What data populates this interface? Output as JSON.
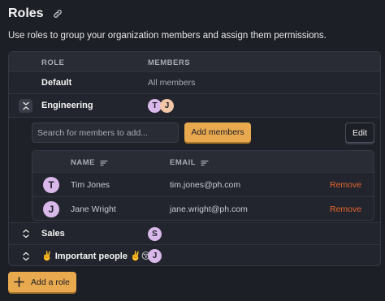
{
  "page": {
    "title": "Roles",
    "description": "Use roles to group your organization members and assign them permissions."
  },
  "table": {
    "col_role": "ROLE",
    "col_members": "MEMBERS",
    "roles": [
      {
        "name": "Default",
        "members_text": "All members"
      },
      {
        "name": "Engineering",
        "avatars": [
          "T",
          "J"
        ]
      },
      {
        "name": "Sales",
        "avatars": [
          "S"
        ]
      },
      {
        "name": "✌️ Important people ✌️😚",
        "avatars": [
          "J"
        ]
      }
    ]
  },
  "expanded": {
    "search_placeholder": "Search for members to add...",
    "add_members_label": "Add members",
    "edit_label": "Edit",
    "col_name": "NAME",
    "col_email": "EMAIL",
    "members": [
      {
        "initial": "T",
        "name": "Tim Jones",
        "email": "tim.jones@ph.com",
        "action": "Remove"
      },
      {
        "initial": "J",
        "name": "Jane Wright",
        "email": "jane.wright@ph.com",
        "action": "Remove"
      }
    ]
  },
  "footer": {
    "add_role_label": "Add a role"
  },
  "colors": {
    "background": "#1d1f27",
    "accent": "#e8a94f",
    "danger": "#e8642c",
    "avatar_purple": "#d9b8ea",
    "avatar_peach": "#f2c6a8"
  },
  "icons": {
    "title": "link-icon",
    "expanded_toggle": "collapse-icon",
    "collapsed_toggle": "expand-icon",
    "sort": "sort-icon",
    "add": "plus-icon"
  }
}
